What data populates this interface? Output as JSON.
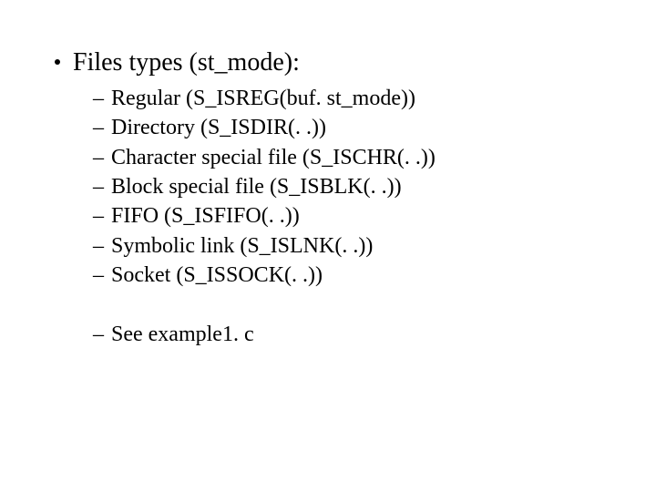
{
  "slide": {
    "heading": "Files types (st_mode):",
    "items": [
      "Regular (S_ISREG(buf. st_mode))",
      "Directory (S_ISDIR(. .))",
      "Character special file (S_ISCHR(. .))",
      "Block special file (S_ISBLK(. .))",
      "FIFO (S_ISFIFO(. .))",
      "Symbolic link (S_ISLNK(. .))",
      "Socket (S_ISSOCK(. .))"
    ],
    "footer_item": "See example1. c"
  }
}
